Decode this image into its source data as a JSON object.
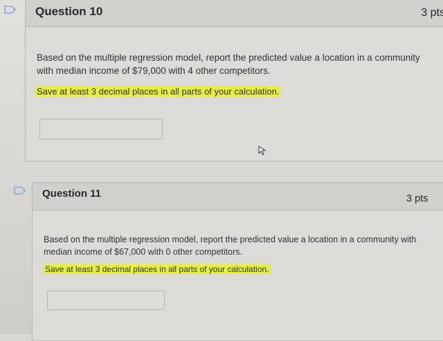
{
  "questions": [
    {
      "title": "Question 10",
      "points": "3 pts",
      "text": "Based on the multiple regression model, report the predicted value a location in a community with median income of $79,000 with 4 other competitors.",
      "note": "Save at least 3 decimal places in all parts of your calculation.",
      "answer": ""
    },
    {
      "title": "Question 11",
      "points": "3 pts",
      "text": "Based on the multiple regression model, report the predicted value a location in a community with median income of $67,000 with 0 other competitors.",
      "note": "Save at least 3 decimal places in all parts of your calculation.",
      "answer": ""
    }
  ],
  "colors": {
    "highlight": "#e6ee3f",
    "flag_outline": "#8aa9d6"
  }
}
